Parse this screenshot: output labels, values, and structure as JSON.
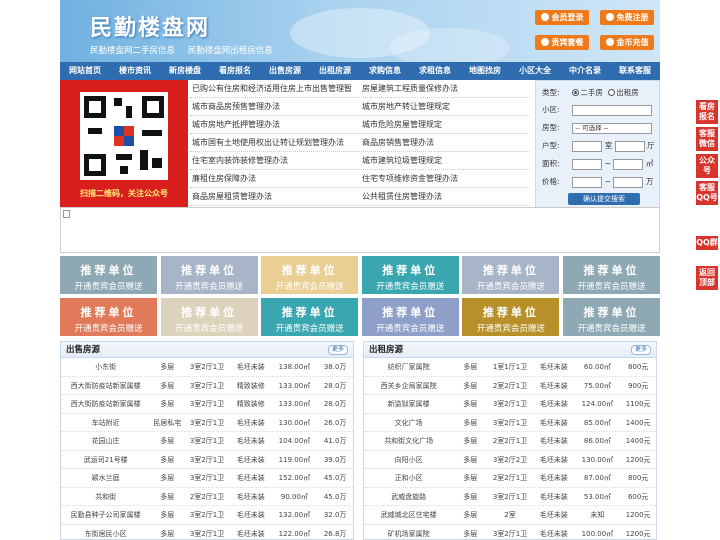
{
  "header": {
    "logo": "民勤楼盘网",
    "taglines": [
      "民勤楼盘网二手房信息",
      "民勤楼盘网出租房信息"
    ],
    "buttons": [
      "会员登录",
      "免费注册",
      "贵宾套餐",
      "金币充值"
    ]
  },
  "nav": [
    "网站首页",
    "楼市资讯",
    "新房楼盘",
    "看房报名",
    "出售房源",
    "出租房源",
    "求购信息",
    "求租信息",
    "地图找房",
    "小区大全",
    "中介名录",
    "联系客服"
  ],
  "qr": {
    "caption": "扫描二维码，关注公众号"
  },
  "links": [
    [
      "已购公有住房和经济适用住房上市出售管理暂",
      "房屋建筑工程质量保修办法"
    ],
    [
      "城市商品房预售管理办法",
      "城市房地产转让管理规定"
    ],
    [
      "城市房地产抵押管理办法",
      "城市危险房屋管理规定"
    ],
    [
      "城市国有土地使用权出让转让规划管理办法",
      "商品房销售管理办法"
    ],
    [
      "住宅室内装饰装修管理办法",
      "城市建筑垃圾管理规定"
    ],
    [
      "廉租住房保障办法",
      "住宅专项维修资金管理办法"
    ],
    [
      "商品房屋租赁管理办法",
      "公共租赁住房管理办法"
    ]
  ],
  "search": {
    "type_label": "类型:",
    "type_options": [
      "二手房",
      "出租房"
    ],
    "community_label": "小区:",
    "room_type_label": "房型:",
    "room_type_value": "-- 可选择 --",
    "layout_label": "户型:",
    "layout_unit1": "室",
    "layout_unit2": "厅",
    "area_label": "面积:",
    "area_unit": "㎡",
    "area_sep": "~",
    "price_label": "价格:",
    "price_unit": "万",
    "price_sep": "~",
    "submit": "确认提交搜索"
  },
  "tiles": {
    "title": "推荐单位",
    "subtitle": "开通贵宾会员赠送",
    "colors": [
      "#8fa9b4",
      "#a8b4c8",
      "#e9cf93",
      "#3aa6b0",
      "#a8b4c8",
      "#8fa9b4",
      "#e07a5a",
      "#ddd3bd",
      "#3aa6b0",
      "#8ea0c8",
      "#b8902a",
      "#8fa9b4"
    ]
  },
  "sale": {
    "title": "出售房源",
    "more": "更多",
    "rows": [
      [
        "小东街",
        "多层",
        "3室2厅1卫",
        "毛坯未装",
        "138.00㎡",
        "38.0万"
      ],
      [
        "西大街防疫站新家属楼",
        "多层",
        "3室2厅1卫",
        "精致装修",
        "133.00㎡",
        "28.0万"
      ],
      [
        "西大街防疫站新家属楼",
        "多层",
        "3室2厅1卫",
        "精致装修",
        "133.00㎡",
        "28.0万"
      ],
      [
        "车站附近",
        "民居私宅",
        "3室2厅1卫",
        "毛坯未装",
        "130.00㎡",
        "26.0万"
      ],
      [
        "花园山庄",
        "多层",
        "3室2厅1卫",
        "毛坯未装",
        "104.00㎡",
        "41.0万"
      ],
      [
        "武运司21号楼",
        "多层",
        "3室2厅1卫",
        "毛坯未装",
        "119.00㎡",
        "39.0万"
      ],
      [
        "颖水兰庭",
        "多层",
        "3室2厅1卫",
        "毛坯未装",
        "152.00㎡",
        "45.0万"
      ],
      [
        "共和街",
        "多层",
        "2室2厅1卫",
        "毛坯未装",
        "90.00㎡",
        "45.0万"
      ],
      [
        "民勤县种子公司家属楼",
        "多层",
        "3室2厅1卫",
        "毛坯未装",
        "132.00㎡",
        "32.0万"
      ],
      [
        "东街居民小区",
        "多层",
        "3室2厅1卫",
        "毛坯未装",
        "122.00㎡",
        "26.8万"
      ]
    ]
  },
  "rent": {
    "title": "出租房源",
    "more": "更多",
    "rows": [
      [
        "纺织厂家属院",
        "多层",
        "1室1厅1卫",
        "毛坯未装",
        "60.00㎡",
        "800元"
      ],
      [
        "西关乡企局家属院",
        "多层",
        "2室2厅1卫",
        "毛坯未装",
        "75.00㎡",
        "900元"
      ],
      [
        "新监狱家属楼",
        "多层",
        "3室2厅1卫",
        "毛坯未装",
        "124.00㎡",
        "1100元"
      ],
      [
        "文化广场",
        "多层",
        "3室2厅1卫",
        "毛坯未装",
        "85.00㎡",
        "1400元"
      ],
      [
        "共和街文化广场",
        "多层",
        "2室2厅1卫",
        "毛坯未装",
        "86.00㎡",
        "1400元"
      ],
      [
        "向阳小区",
        "多层",
        "3室2厅2卫",
        "毛坯未装",
        "130.00㎡",
        "1200元"
      ],
      [
        "正和小区",
        "多层",
        "2室2厅1卫",
        "毛坯未装",
        "87.00㎡",
        "800元"
      ],
      [
        "武威盘旋路",
        "多层",
        "3室2厅1卫",
        "毛坯未装",
        "53.00㎡",
        "600元"
      ],
      [
        "武威城北区住宅楼",
        "多层",
        "2室",
        "毛坯未装",
        "未知",
        "1200元"
      ],
      [
        "矿机场家属院",
        "多层",
        "3室2厅1卫",
        "毛坯未装",
        "100.00㎡",
        "1200元"
      ]
    ]
  },
  "side_buttons": [
    "看房报名",
    "客服微信",
    "公众号",
    "客服QQ号",
    "QQ群",
    "返回顶部"
  ]
}
